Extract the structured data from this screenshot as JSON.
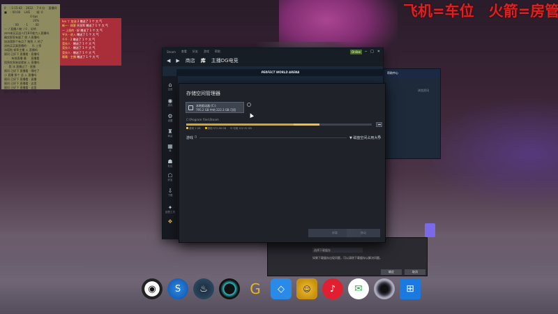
{
  "overlay": {
    "slogan": "飞机=车位　火箭=房管"
  },
  "stats_panel": {
    "rows": [
      "0 　: 1:15:42　 2022 　7 4 分　 直播间 FPS: 60",
      "■ 　: 00:00 　LiVE 　　帧: 0",
      "　　　　　　　　　 0 bps",
      "　　　　　　　　　 　20%",
      "·　　　: 00　　· 1　　· 00",
      "",
      "一 ·/ 直播人物 ·/ 0 ，好的",
      "zzm来买买送人们(8不能力入直播吗",
      "确实那家有量了 朋 人直播吗",
      "加油我那个有点了 拖到 人 的了",
      "送给买买真直播的 · 　乐 上领",
      "冰塔啦 帧率主播 入 直播吗",
      "顾问 已好下 直播看 · 直播吗",
      "　· 　有效直播 最 　 直播看",
      "找到吃到来说就来 入 直播吗",
      "· 　我 冰 直播过了 · 直播",
      "顾问 已好下 直播看 · 哦吃了",
      "小 直播 那个 总 入 直播吗",
      "顾问 已好下 直播看 · 直播",
      "顾问 已好下 直播看 · 这里",
      "顾问 已好下 直播看 · 这里",
      "顾问 已好下 直播看 · 下面"
    ]
  },
  "chat_panel": {
    "rows": [
      {
        "nick": "Ivo 丫 加油",
        "text": "2 赠送了 1 个 大 气"
      },
      {
        "nick": "新一 · 顾客",
        "text": "开冠军 赠送了 1 个 大 气"
      },
      {
        "nick": "一 上班的 ·",
        "text": "好 赠送了 1 个 大 气"
      },
      {
        "nick": "平头 · 进入",
        "text": "赠送了 1 个 大 气"
      },
      {
        "nick": "千千 · 2",
        "text": "赠送了 1 个 大 气"
      },
      {
        "nick": "竞技人 ·",
        "text": "赠送了 1 个 大 气"
      },
      {
        "nick": "竞技人 ·",
        "text": "赠送了 1 个 大 气"
      },
      {
        "nick": "竞技人 ·",
        "text": "赠送了 1 个 大 气"
      },
      {
        "nick": "哦哦 · 主播",
        "text": "赠送了 1 个 大 气"
      }
    ]
  },
  "steam": {
    "menubar": [
      "Steam",
      "查看",
      "好友",
      "游戏",
      "帮助"
    ],
    "nav": {
      "back": "◀",
      "forward": "▶",
      "tabs": [
        {
          "label": "商店",
          "active": false
        },
        {
          "label": "库",
          "active": true
        }
      ],
      "location": "主播DG电竞"
    },
    "friends_status": "Online",
    "window_controls": [
      "─",
      "□",
      "✕"
    ],
    "banner": "PERFECT WORLD ARENA",
    "rail": [
      {
        "icon": "⌂",
        "label": "主页",
        "name": "home"
      },
      {
        "icon": "◉",
        "label": "资讯",
        "name": "news"
      },
      {
        "icon": "⚙",
        "label": "设置",
        "name": "settings"
      },
      {
        "icon": "♜",
        "label": "商店",
        "name": "store"
      },
      {
        "icon": "▦",
        "label": "库",
        "name": "library"
      },
      {
        "icon": "☗",
        "label": "社区",
        "name": "community"
      },
      {
        "icon": "☖",
        "label": "好友",
        "name": "friends"
      },
      {
        "icon": "⇩",
        "label": "下载",
        "name": "downloads"
      },
      {
        "icon": "✦",
        "label": "创意工坊",
        "name": "workshop"
      },
      {
        "icon": "❖",
        "label": "",
        "name": "points"
      }
    ]
  },
  "second_window": {
    "title": "帮助中心",
    "link": "浏览资讯"
  },
  "storage": {
    "title": "存储空间管理器",
    "drive": {
      "name": "本地驱动器 (C:)",
      "size": "795.2 GB 中的 222.3 GB 可用"
    },
    "path": "C:\\Program Files\\Steam",
    "usage": {
      "steam_fraction": 0.58,
      "other_fraction": 0.14
    },
    "legend": [
      {
        "label": "游戏",
        "value": "1 GB",
        "color": "#f0c040"
      },
      {
        "label": "其他",
        "value": "572.88 GB",
        "color": "#d9a825"
      },
      {
        "label": "可用",
        "value": "222.32 GB",
        "color": "#3d4450"
      }
    ],
    "games_label": "游戏",
    "games_count": "0",
    "sort_label": "▼ 磁盘空间占用大小",
    "sort_options_icon": "⚟",
    "buttons": [
      "卸载",
      "移动"
    ]
  },
  "bg_dialog": {
    "field": "选择下载缓存",
    "hint": "如果下载缓存出现问题，可以清除下载缓存以解决问题。",
    "buttons": [
      "确定",
      "取消"
    ]
  },
  "dock": [
    {
      "name": "obs",
      "glyph": "◉"
    },
    {
      "name": "s-app",
      "glyph": "S"
    },
    {
      "name": "steam",
      "glyph": "♨"
    },
    {
      "name": "ring",
      "glyph": ""
    },
    {
      "name": "yellow",
      "glyph": "G"
    },
    {
      "name": "blue-sq",
      "glyph": "◇"
    },
    {
      "name": "mascot",
      "glyph": "☺"
    },
    {
      "name": "netease",
      "glyph": "♪"
    },
    {
      "name": "wechat",
      "glyph": "✉"
    },
    {
      "name": "camera",
      "glyph": ""
    },
    {
      "name": "windows",
      "glyph": "⊞"
    }
  ]
}
